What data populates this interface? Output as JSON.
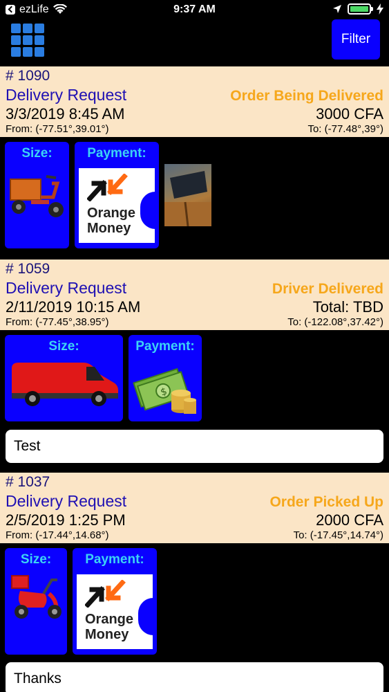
{
  "status_bar": {
    "back_app": "ezLife",
    "time": "9:37 AM"
  },
  "nav": {
    "filter_label": "Filter"
  },
  "tile_labels": {
    "size": "Size:",
    "payment": "Payment:"
  },
  "payment_brand": {
    "line1": "Orange",
    "line2": "Money"
  },
  "orders": [
    {
      "id": "# 1090",
      "type": "Delivery Request",
      "status": "Order Being Delivered",
      "datetime": "3/3/2019 8:45 AM",
      "price": "3000 CFA",
      "from": "From:  (-77.51°,39.01°)",
      "to": "To:  (-77.48°,39°)",
      "vehicle": "cargo-tricycle",
      "payment": "Orange Money"
    },
    {
      "id": "# 1059",
      "type": "Delivery Request",
      "status": "Driver Delivered",
      "datetime": "2/11/2019 10:15 AM",
      "price": "Total: TBD",
      "from": "From:  (-77.45°,38.95°)",
      "to": "To:  (-122.08°,37.42°)",
      "vehicle": "van",
      "payment": "cash",
      "comment": "Test"
    },
    {
      "id": "# 1037",
      "type": "Delivery Request",
      "status": "Order Picked Up",
      "datetime": "2/5/2019 1:25 PM",
      "price": "2000 CFA",
      "from": "From:  (-17.44°,14.68°)",
      "to": "To:  (-17.45°,14.74°)",
      "vehicle": "scooter",
      "payment": "Orange Money",
      "comment": "Thanks"
    }
  ],
  "colors": {
    "header_bg": "#fbe5c6",
    "tile_blue": "#0a00ff",
    "status_orange": "#f6a71b",
    "label_cyan": "#3cd3f5",
    "type_blue": "#1f10b3"
  }
}
